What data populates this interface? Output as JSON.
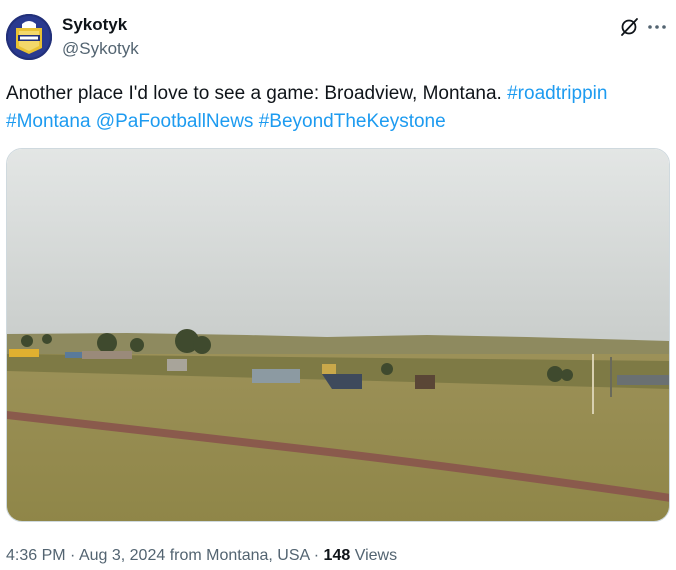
{
  "author": {
    "display_name": "Sykotyk",
    "handle": "@Sykotyk",
    "avatar_icon": "team-logo-avatar"
  },
  "tweet": {
    "text_plain": "Another place I'd love to see a game: Broadview, Montana.",
    "hashtag_roadtrippin": "#roadtrippin",
    "hashtag_montana": "#Montana",
    "mention": "@PaFootballNews",
    "hashtag_keystone": "#BeyondTheKeystone"
  },
  "media": {
    "description_icon": "landscape-photo"
  },
  "meta": {
    "time": "4:36 PM",
    "date": "Aug 3, 2024",
    "location": "from Montana, USA",
    "views_count": "148",
    "views_label": "Views"
  },
  "colors": {
    "link": "#1d9bf0",
    "text": "#0f1419",
    "secondary": "#536471"
  }
}
